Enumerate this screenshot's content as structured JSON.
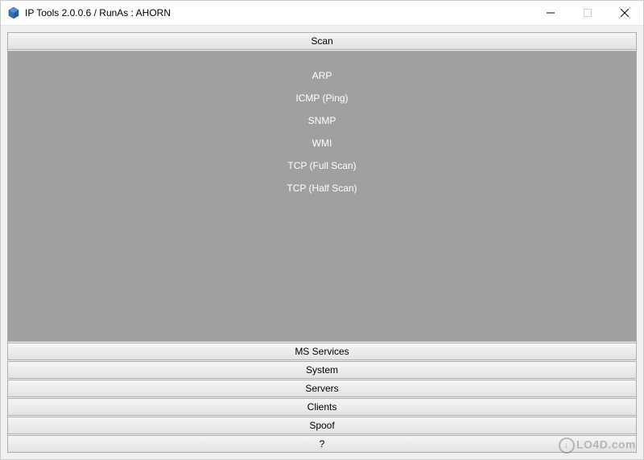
{
  "titlebar": {
    "title": "IP Tools 2.0.0.6 / RunAs : AHORN"
  },
  "sections": {
    "scan": {
      "header": "Scan",
      "items": [
        "ARP",
        "ICMP (Ping)",
        "SNMP",
        "WMI",
        "TCP (Full Scan)",
        "TCP (Half Scan)"
      ]
    },
    "ms_services": "MS Services",
    "system": "System",
    "servers": "Servers",
    "clients": "Clients",
    "spoof": "Spoof",
    "help": "?"
  },
  "watermark": "LO4D.com"
}
